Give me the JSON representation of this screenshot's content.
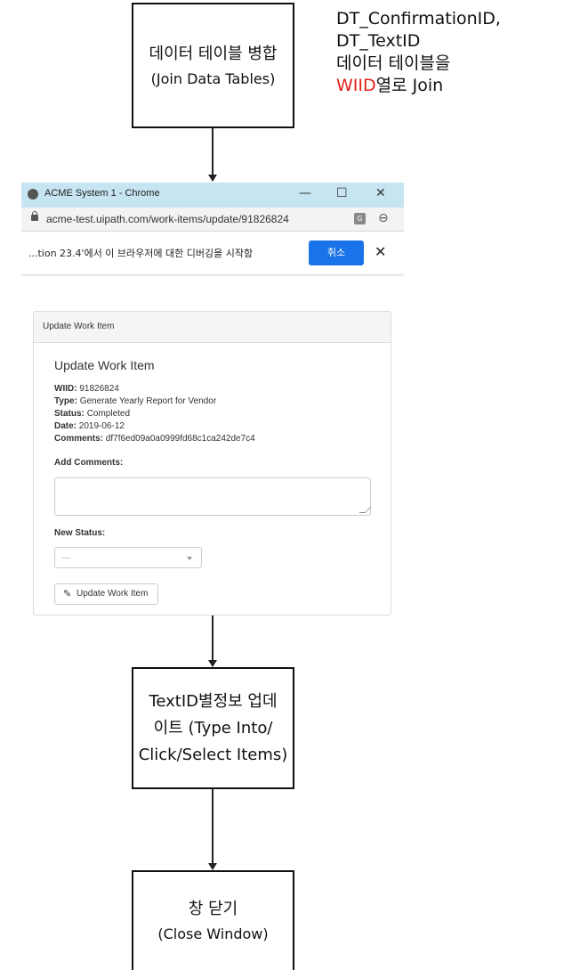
{
  "flow": {
    "step1": {
      "line1": "데이터 테이블 병합",
      "line2": "(Join Data Tables)"
    },
    "step2": {
      "line1": "TextID별정보 업데",
      "line2": "이트 (Type Into/",
      "line3": "Click/Select Items)"
    },
    "step3": {
      "line1": "창 닫기",
      "line2": "(Close Window)"
    }
  },
  "annotation": {
    "line1": "DT_ConfirmationID,",
    "line2": "DT_TextID",
    "line3": "데이터 테이블을",
    "line4_highlight": "WIID",
    "line4_rest": "열로 Join",
    "highlight_color": "#e0201a"
  },
  "browser": {
    "window_title": "ACME System 1 - Chrome",
    "url": "acme-test.uipath.com/work-items/update/91826824",
    "minimize": "—",
    "maximize": "☐",
    "close": "✕",
    "infobar_message": "...tion 23.4'에서 이 브라우저에 대한 디버깅을 시작함",
    "infobar_cancel": "취소",
    "infobar_close": "✕",
    "panel": {
      "heading": "Update Work Item",
      "title": "Update Work Item",
      "fields": [
        {
          "label": "WIID:",
          "value": "91826824"
        },
        {
          "label": "Type:",
          "value": "Generate Yearly Report for Vendor"
        },
        {
          "label": "Status:",
          "value": "Completed"
        },
        {
          "label": "Date:",
          "value": "2019-06-12"
        },
        {
          "label": "Comments:",
          "value": "df7f6ed09a0a0999fd68c1ca242de7c4"
        }
      ],
      "add_comments_label": "Add Comments:",
      "comments_value": "",
      "new_status_label": "New Status:",
      "new_status_selected": "---",
      "update_button": "Update Work Item"
    }
  }
}
